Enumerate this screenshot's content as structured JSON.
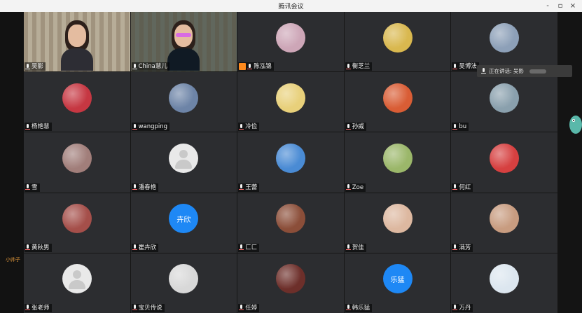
{
  "window": {
    "title": "腾讯会议",
    "controls": {
      "minimize": "-",
      "maximize": "▫",
      "close": "×"
    }
  },
  "speaking_indicator": {
    "label": "正在讲话: 吴影"
  },
  "side_label": "小帅子",
  "participants": [
    {
      "name": "吴影",
      "type": "video",
      "avatar_color": "#b7ad98",
      "host": false,
      "muted": false
    },
    {
      "name": "China慧儿",
      "type": "video",
      "avatar_color": "#61675d",
      "host": false,
      "muted": false
    },
    {
      "name": "陈泓锦",
      "type": "avatar",
      "avatar_color": "#cda6b7",
      "host": true,
      "muted": true
    },
    {
      "name": "衡芝兰",
      "type": "avatar",
      "avatar_color": "#d9b84f",
      "host": false,
      "muted": true
    },
    {
      "name": "吴博法",
      "type": "avatar",
      "avatar_color": "#8da0b8",
      "host": false,
      "muted": true
    },
    {
      "name": "杨艳慧",
      "type": "avatar",
      "avatar_color": "#c63742",
      "host": false,
      "muted": true
    },
    {
      "name": "wangping",
      "type": "avatar",
      "avatar_color": "#6d84a7",
      "host": false,
      "muted": true
    },
    {
      "name": "冷俭",
      "type": "avatar",
      "avatar_color": "#e8d07a",
      "host": false,
      "muted": true
    },
    {
      "name": "孙威",
      "type": "avatar",
      "avatar_color": "#d95d35",
      "host": false,
      "muted": true
    },
    {
      "name": "bu",
      "type": "avatar",
      "avatar_color": "#8aa0ad",
      "host": false,
      "muted": true
    },
    {
      "name": "雪",
      "type": "avatar",
      "avatar_color": "#a17e7a",
      "host": false,
      "muted": true
    },
    {
      "name": "潘春艳",
      "type": "default",
      "avatar_color": "#e9e9e9",
      "host": false,
      "muted": true
    },
    {
      "name": "王蕾",
      "type": "avatar",
      "avatar_color": "#4a8bd4",
      "host": false,
      "muted": true
    },
    {
      "name": "Zoe",
      "type": "avatar",
      "avatar_color": "#9bb76a",
      "host": false,
      "muted": true
    },
    {
      "name": "何红",
      "type": "avatar",
      "avatar_color": "#d64040",
      "host": false,
      "muted": true
    },
    {
      "name": "黄秋男",
      "type": "avatar",
      "avatar_color": "#a54f4a",
      "host": false,
      "muted": true
    },
    {
      "name": "瞿卉欣",
      "type": "text",
      "avatar_color": "#1e88f5",
      "initials": "卉欣",
      "host": false,
      "muted": true
    },
    {
      "name": "匚匚",
      "type": "avatar",
      "avatar_color": "#8b4e39",
      "host": false,
      "muted": true
    },
    {
      "name": "贺佳",
      "type": "avatar",
      "avatar_color": "#ddb8a0",
      "host": false,
      "muted": true
    },
    {
      "name": "满芳",
      "type": "avatar",
      "avatar_color": "#c89c80",
      "host": false,
      "muted": true
    },
    {
      "name": "张老师",
      "type": "default",
      "avatar_color": "#e9e9e9",
      "host": false,
      "muted": true
    },
    {
      "name": "宝贝传说",
      "type": "avatar",
      "avatar_color": "#d8d8d8",
      "host": false,
      "muted": true
    },
    {
      "name": "任婷",
      "type": "avatar",
      "avatar_color": "#6d2f2a",
      "host": false,
      "muted": true
    },
    {
      "name": "韩乐猛",
      "type": "text",
      "avatar_color": "#1e88f5",
      "initials": "乐猛",
      "host": false,
      "muted": true
    },
    {
      "name": "万丹",
      "type": "avatar",
      "avatar_color": "#dce6ef",
      "host": false,
      "muted": true
    }
  ]
}
